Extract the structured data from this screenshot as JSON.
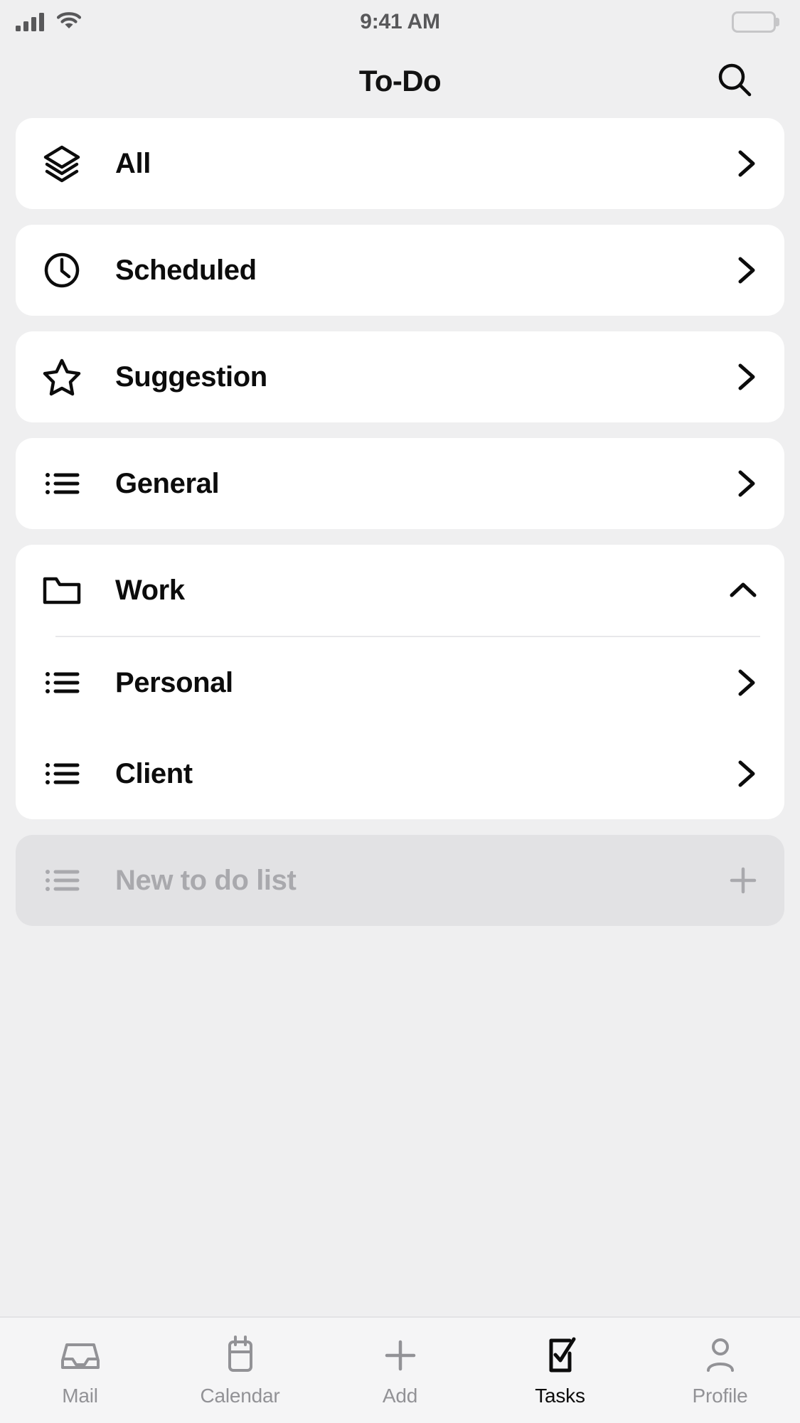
{
  "status_bar": {
    "time": "9:41 AM",
    "signal_icon": "signal-bars-icon",
    "wifi_icon": "wifi-icon",
    "battery_icon": "battery-full-icon",
    "battery_level": "100"
  },
  "header": {
    "title": "To-Do",
    "search_icon": "search-icon"
  },
  "lists": [
    {
      "label": "All",
      "icon": "layers-icon",
      "trail": "chevron-right-icon"
    },
    {
      "label": "Scheduled",
      "icon": "clock-icon",
      "trail": "chevron-right-icon"
    },
    {
      "label": "Suggestion",
      "icon": "star-icon",
      "trail": "chevron-right-icon"
    },
    {
      "label": "General",
      "icon": "list-icon",
      "trail": "chevron-right-icon"
    }
  ],
  "folder": {
    "label": "Work",
    "icon": "folder-icon",
    "trail": "chevron-up-icon",
    "expanded": true,
    "children": [
      {
        "label": "Personal",
        "icon": "list-icon",
        "trail": "chevron-right-icon"
      },
      {
        "label": "Client",
        "icon": "list-icon",
        "trail": "chevron-right-icon"
      }
    ]
  },
  "new_list": {
    "label": "New to do list",
    "icon": "list-icon",
    "trail": "plus-icon"
  },
  "tab_bar": {
    "items": [
      {
        "label": "Mail",
        "icon": "inbox-icon",
        "active": false
      },
      {
        "label": "Calendar",
        "icon": "calendar-icon",
        "active": false
      },
      {
        "label": "Add",
        "icon": "plus-icon",
        "active": false
      },
      {
        "label": "Tasks",
        "icon": "tasks-icon",
        "active": true
      },
      {
        "label": "Profile",
        "icon": "person-icon",
        "active": false
      }
    ]
  },
  "colors": {
    "background": "#efeff0",
    "card": "#ffffff",
    "new_list_bg": "#e2e2e4",
    "text_primary": "#0c0c0c",
    "text_muted": "#a9a9ad",
    "tab_inactive": "#929296",
    "tab_bar_bg": "#f5f5f6"
  }
}
